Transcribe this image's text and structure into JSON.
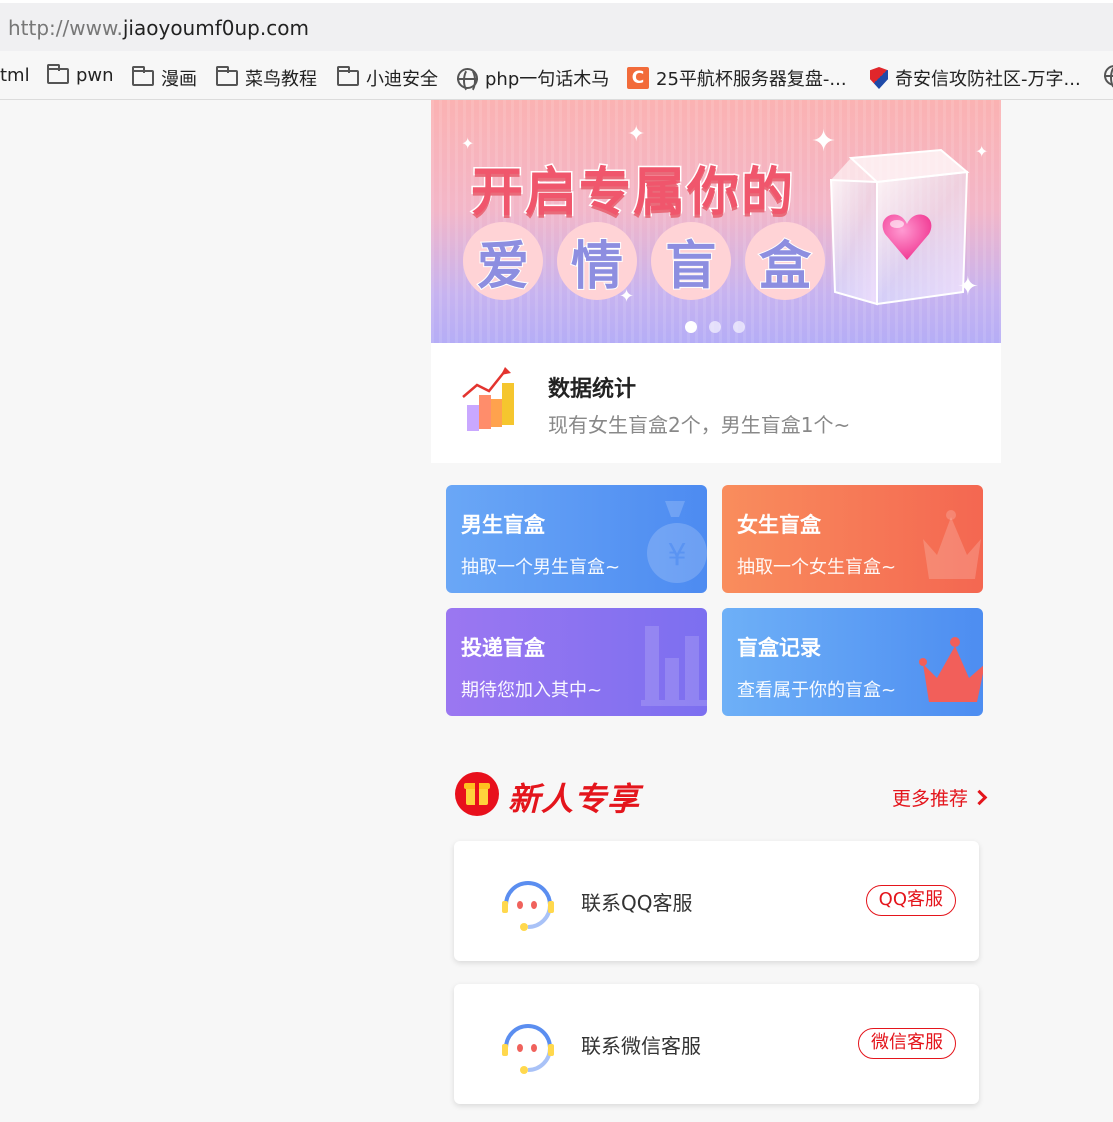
{
  "browser": {
    "url_proto": "http://www.",
    "url_host": "jiaoyoumf0up.com",
    "bookmarks": [
      {
        "label": "tml",
        "icon": "none"
      },
      {
        "label": "pwn",
        "icon": "folder-icon"
      },
      {
        "label": "漫画",
        "icon": "folder-icon"
      },
      {
        "label": "菜鸟教程",
        "icon": "folder-icon"
      },
      {
        "label": "小迪安全",
        "icon": "folder-icon"
      },
      {
        "label": "php一句话木马",
        "icon": "globe-icon"
      },
      {
        "label": "25平航杯服务器复盘-...",
        "icon": "c-logo-icon"
      },
      {
        "label": "奇安信攻防社区-万字...",
        "icon": "shield-logo-icon"
      }
    ]
  },
  "banner": {
    "line1": "开启专属你的",
    "line2": [
      "爱",
      "情",
      "盲",
      "盒"
    ],
    "carousel_count": 3,
    "carousel_active": 0
  },
  "stats": {
    "title": "数据统计",
    "subtitle": "现有女生盲盒2个，男生盲盒1个~"
  },
  "cards": [
    {
      "title": "男生盲盒",
      "subtitle": "抽取一个男生盲盒~",
      "icon": "money-bag-icon"
    },
    {
      "title": "女生盲盒",
      "subtitle": "抽取一个女生盲盒~",
      "icon": "crown-icon"
    },
    {
      "title": "投递盲盒",
      "subtitle": "期待您加入其中~",
      "icon": "bar-chart-icon"
    },
    {
      "title": "盲盒记录",
      "subtitle": "查看属于你的盲盒~",
      "icon": "crown-icon"
    }
  ],
  "section": {
    "title": "新人专享",
    "more": "更多推荐"
  },
  "services": [
    {
      "label": "联系QQ客服",
      "badge": "QQ客服"
    },
    {
      "label": "联系微信客服",
      "badge": "微信客服"
    }
  ],
  "colors": {
    "accent_red": "#e4151c",
    "card_blue": "#4d8bf1",
    "card_orange": "#f46751",
    "card_purple": "#7c6ff0"
  }
}
